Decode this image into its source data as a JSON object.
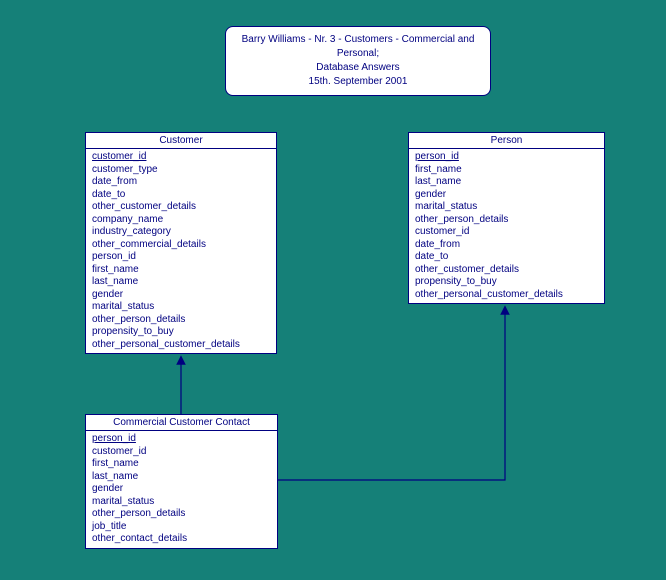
{
  "title": {
    "line1": "Barry Williams - Nr. 3 - Customers - Commercial and Personal;",
    "line2": "Database Answers",
    "line3": "15th. September 2001"
  },
  "entities": {
    "customer": {
      "name": "Customer",
      "pk": "customer_id",
      "fields": [
        "customer_type",
        "date_from",
        "date_to",
        "other_customer_details",
        "company_name",
        "industry_category",
        "other_commercial_details",
        "person_id",
        "first_name",
        "last_name",
        "gender",
        "marital_status",
        "other_person_details",
        "propensity_to_buy",
        "other_personal_customer_details"
      ]
    },
    "person": {
      "name": "Person",
      "pk": "person_id",
      "fields": [
        "first_name",
        "last_name",
        "gender",
        "marital_status",
        "other_person_details",
        "customer_id",
        "date_from",
        "date_to",
        "other_customer_details",
        "propensity_to_buy",
        "other_personal_customer_details"
      ]
    },
    "contact": {
      "name": "Commercial Customer Contact",
      "pk": "person_id",
      "fields": [
        "customer_id",
        "first_name",
        "last_name",
        "gender",
        "marital_status",
        "other_person_details",
        "job_title",
        "other_contact_details"
      ]
    }
  },
  "relationships": [
    {
      "from": "Commercial Customer Contact",
      "to": "Customer",
      "via": "customer_id"
    },
    {
      "from": "Commercial Customer Contact",
      "to": "Person",
      "via": "person_id"
    }
  ]
}
